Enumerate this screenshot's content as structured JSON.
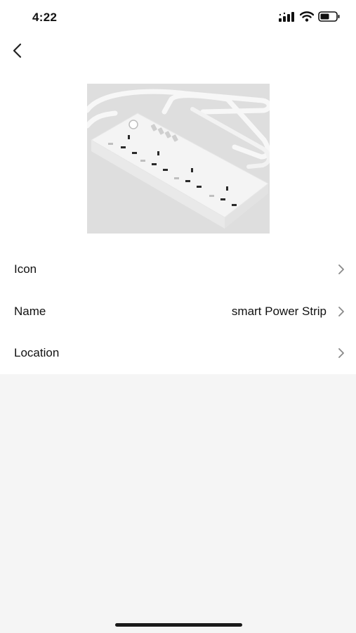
{
  "status_bar": {
    "time": "4:22",
    "icons": [
      "signal-icon",
      "wifi-icon",
      "battery-icon"
    ]
  },
  "nav": {
    "back_icon": "chevron-left-icon"
  },
  "device": {
    "image": "power-strip-image"
  },
  "settings": [
    {
      "label": "Icon",
      "value": ""
    },
    {
      "label": "Name",
      "value": "smart Power Strip"
    },
    {
      "label": "Location",
      "value": ""
    }
  ],
  "colors": {
    "background": "#f5f5f5",
    "card": "#ffffff",
    "text": "#111111",
    "chevron": "#8a8a8a"
  }
}
